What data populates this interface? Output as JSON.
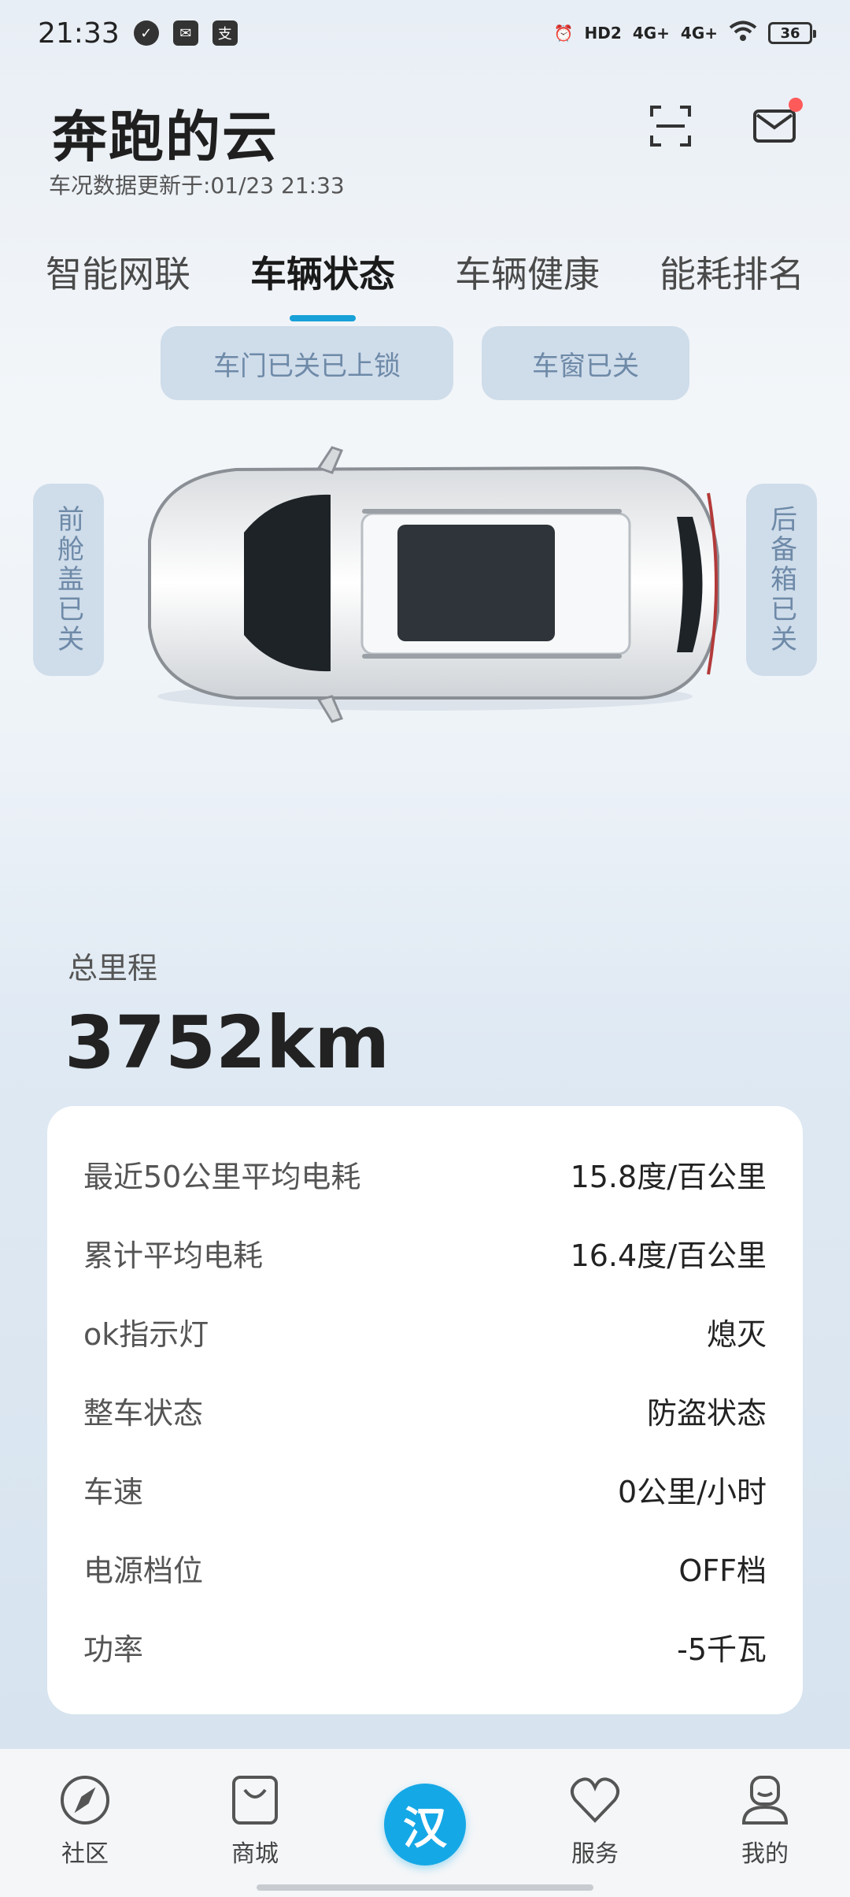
{
  "status_bar": {
    "time": "21:33",
    "badges": [
      "✓",
      "✉",
      "支"
    ],
    "right": [
      "⏰",
      "HD2",
      "4G+",
      "4G+",
      "WiFi"
    ],
    "battery": "36"
  },
  "header": {
    "title": "奔跑的云",
    "updated": "车况数据更新于:01/23 21:33"
  },
  "tabs": [
    {
      "label": "智能网联"
    },
    {
      "label": "车辆状态"
    },
    {
      "label": "车辆健康"
    },
    {
      "label": "能耗排名"
    }
  ],
  "status_chips": {
    "door": "车门已关已上锁",
    "window": "车窗已关",
    "front": "前舱盖已关",
    "rear": "后备箱已关"
  },
  "mileage": {
    "label": "总里程",
    "value": "3752km"
  },
  "info_rows": [
    {
      "key": "最近50公里平均电耗",
      "value": "15.8度/百公里"
    },
    {
      "key": "累计平均电耗",
      "value": "16.4度/百公里"
    },
    {
      "key": "ok指示灯",
      "value": "熄灭"
    },
    {
      "key": "整车状态",
      "value": "防盗状态"
    },
    {
      "key": "车速",
      "value": "0公里/小时"
    },
    {
      "key": "电源档位",
      "value": "OFF档"
    },
    {
      "key": "功率",
      "value": "-5千瓦"
    }
  ],
  "bottom_nav": {
    "community": "社区",
    "mall": "商城",
    "center": "汉",
    "service": "服务",
    "mine": "我的"
  },
  "colors": {
    "accent": "#18a0d8",
    "chip_bg": "#cfdcea",
    "chip_text": "#6e8aa8",
    "notification": "#ff5a5a"
  }
}
